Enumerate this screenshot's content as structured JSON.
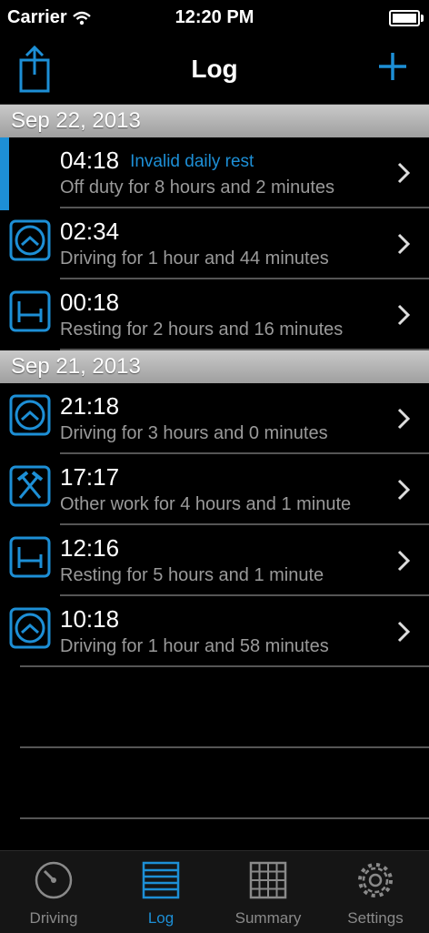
{
  "status_bar": {
    "carrier": "Carrier",
    "time": "12:20 PM"
  },
  "nav": {
    "title": "Log",
    "share_icon": "share-icon",
    "add_icon": "plus-icon"
  },
  "colors": {
    "accent": "#1d8fd6",
    "secondary_text": "#9a9a9a",
    "background": "#000000"
  },
  "sections": [
    {
      "date": "Sep 22, 2013",
      "entries": [
        {
          "time": "04:18",
          "warning": "Invalid daily rest",
          "description": "Off duty for 8 hours and 2 minutes",
          "icon": "none"
        },
        {
          "time": "02:34",
          "description": "Driving for 1 hour and 44 minutes",
          "icon": "steering-wheel-icon"
        },
        {
          "time": "00:18",
          "description": "Resting for 2 hours and 16 minutes",
          "icon": "bed-icon"
        }
      ]
    },
    {
      "date": "Sep 21, 2013",
      "entries": [
        {
          "time": "21:18",
          "description": "Driving for 3 hours and 0 minutes",
          "icon": "steering-wheel-icon"
        },
        {
          "time": "17:17",
          "description": "Other work for 4 hours and 1 minute",
          "icon": "crossed-hammers-icon"
        },
        {
          "time": "12:16",
          "description": "Resting for 5 hours and 1 minute",
          "icon": "bed-icon"
        },
        {
          "time": "10:18",
          "description": "Driving for 1 hour and 58 minutes",
          "icon": "steering-wheel-icon"
        }
      ]
    }
  ],
  "tabs": [
    {
      "label": "Driving",
      "icon": "speedometer-icon",
      "active": false
    },
    {
      "label": "Log",
      "icon": "list-icon",
      "active": true
    },
    {
      "label": "Summary",
      "icon": "grid-icon",
      "active": false
    },
    {
      "label": "Settings",
      "icon": "gear-icon",
      "active": false
    }
  ]
}
